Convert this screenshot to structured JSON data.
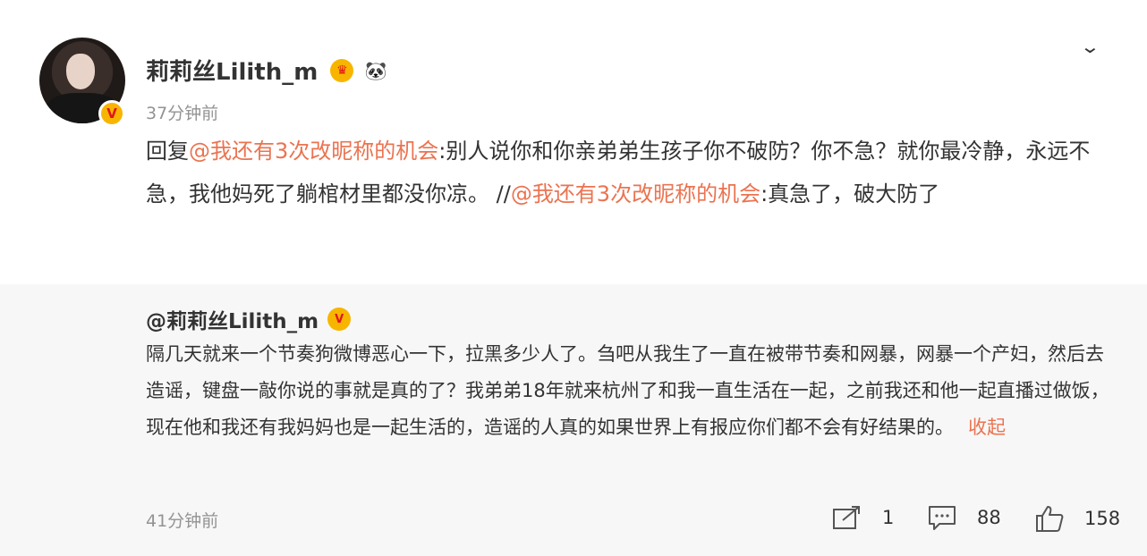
{
  "post": {
    "author": "莉莉丝Lilith_m",
    "time": "37分钟前",
    "reply_prefix": "回复",
    "mention_1": "@我还有3次改昵称的机会",
    "text_part_1": ":别人说你和你亲弟弟生孩子你不破防？你不急？就你最冷静，永远不急，我他妈死了躺棺材里都没你凉。 //",
    "mention_2": "@我还有3次改昵称的机会",
    "text_part_2": ":真急了，破大防了"
  },
  "repost": {
    "author": "@莉莉丝Lilith_m",
    "text": "隔几天就来一个节奏狗微博恶心一下，拉黑多少人了。刍吧从我生了一直在被带节奏和网暴，网暴一个产妇，然后去造谣，键盘一敲你说的事就是真的了？我弟弟18年就来杭州了和我一直生活在一起，之前我还和他一起直播过做饭，现在他和我还有我妈妈也是一起生活的，造谣的人真的如果世界上有报应你们都不会有好结果的。",
    "collapse_label": "收起",
    "time": "41分钟前",
    "shares": "1",
    "comments": "88",
    "likes": "158"
  },
  "icons": {
    "verified": "verified-v-icon",
    "crown": "vip-crown-icon",
    "panda": "panda-badge-icon",
    "chevron": "chevron-down-icon",
    "share": "share-icon",
    "comment": "comment-icon",
    "like": "like-icon"
  },
  "colors": {
    "mention": "#eb7350",
    "meta": "#939393",
    "repost_bg": "#f7f7f7",
    "verified": "#f7b500"
  }
}
